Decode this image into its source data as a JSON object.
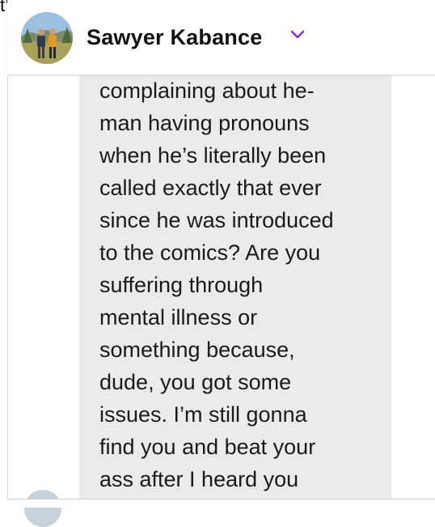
{
  "page_fragment": "t’",
  "header": {
    "contact_name": "Sawyer Kabance",
    "avatar_icon": "profile-photo",
    "chevron_icon": "chevron-down-icon",
    "accent_color": "#8a2be2"
  },
  "message": {
    "lines": [
      "complaining about he-",
      "man having pronouns",
      "when he’s literally been",
      "called exactly that ever",
      "since he was introduced",
      "to the comics? Are you",
      "suffering through",
      "mental illness or",
      "something because,",
      "dude, you got some",
      "issues. I’m still gonna",
      "find you and beat your",
      "ass after I heard you"
    ],
    "bubble_color": "#ebebeb"
  }
}
